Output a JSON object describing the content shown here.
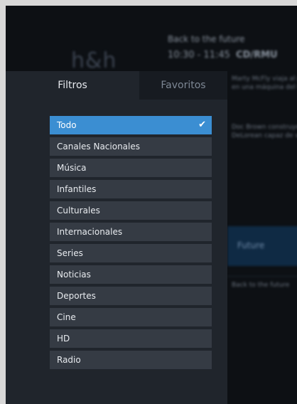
{
  "background": {
    "logo_text": "h&h",
    "program_title": "Back to the future",
    "program_time": "10:30 - 11:45",
    "program_tag": "CD/RMU",
    "desc_lines": [
      "Marty McFly viaja al pasado",
      "en una máquina del tiempo",
      "Doc Brown construye un",
      "DeLorean capaz de viajar"
    ],
    "row_label": "Future",
    "row_desc": "Back to the future"
  },
  "tabs": {
    "filtros": "Filtros",
    "favoritos": "Favoritos",
    "active": "filtros"
  },
  "filters": {
    "selected_index": 0,
    "items": [
      "Todo",
      "Canales Nacionales",
      "Música",
      "Infantiles",
      "Culturales",
      "Internacionales",
      "Series",
      "Noticias",
      "Deportes",
      "Cine",
      "HD",
      "Radio"
    ],
    "check_icon": "checkmark-icon",
    "check_glyph": "✔"
  },
  "colors": {
    "selected": "#3b8ed2",
    "item_bg": "#353b44",
    "panel_bg": "#20252c",
    "screen_bg": "#0d1014"
  }
}
